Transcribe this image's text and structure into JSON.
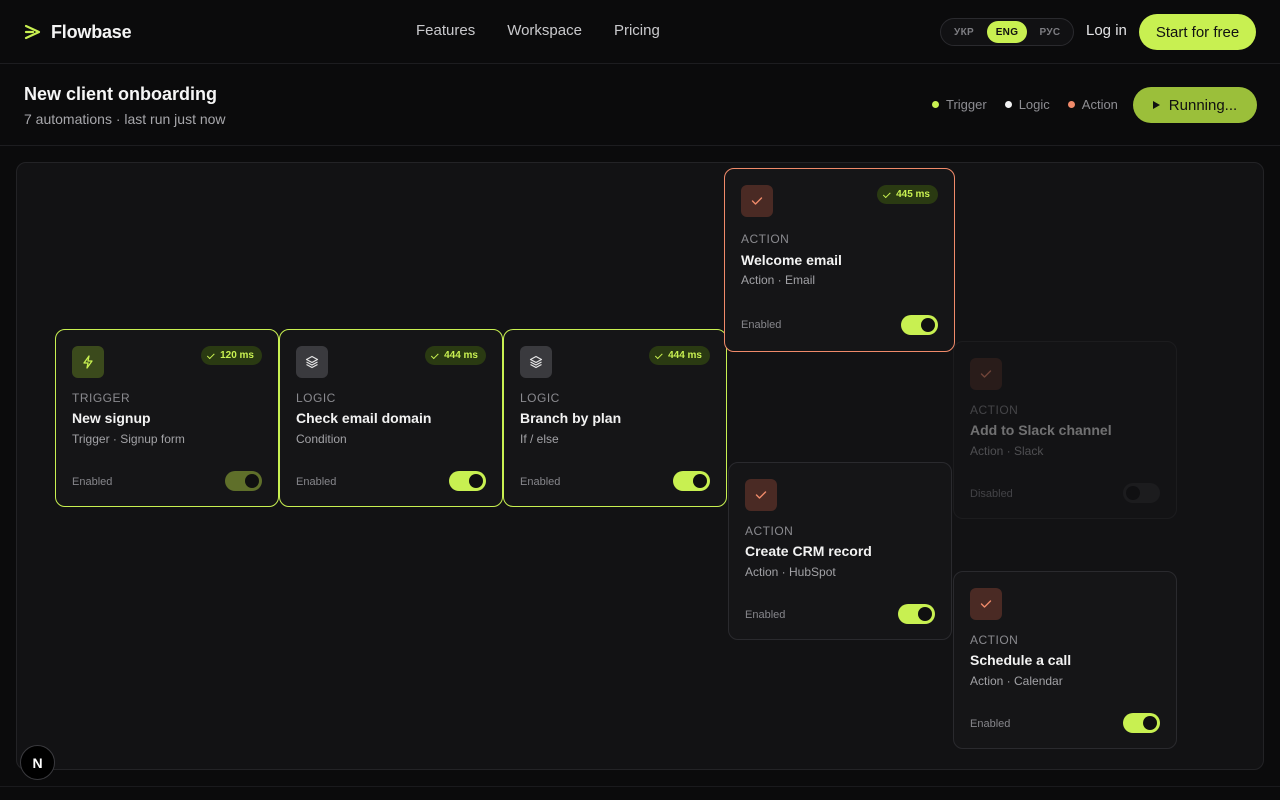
{
  "brand": {
    "name": "Flowbase",
    "accent": "#c8f051"
  },
  "nav": {
    "links": [
      "Features",
      "Workspace",
      "Pricing"
    ],
    "login": "Log in",
    "cta": "Start for free"
  },
  "lang": {
    "options": [
      "УКР",
      "ENG",
      "РУС"
    ],
    "selected": "ENG"
  },
  "header": {
    "title": "New client onboarding",
    "subtitle": "7 automations · last run just now",
    "legend": [
      {
        "label": "Trigger",
        "color": "#c8f051"
      },
      {
        "label": "Logic",
        "color": "#f2f2f2"
      },
      {
        "label": "Action",
        "color": "#f08a6a"
      }
    ],
    "run_label": "Running..."
  },
  "nodes": [
    {
      "kind": "trigger",
      "type": "TRIGGER",
      "title": "New signup",
      "desc": "Trigger · Signup form",
      "badge": "120 ms",
      "status": "Enabled",
      "enabled": true,
      "icon": "bolt-icon"
    },
    {
      "kind": "logic",
      "type": "LOGIC",
      "title": "Check email domain",
      "desc": "Condition",
      "badge": "444 ms",
      "status": "Enabled",
      "enabled": true,
      "icon": "layers-icon"
    },
    {
      "kind": "logic",
      "type": "LOGIC",
      "title": "Branch by plan",
      "desc": "If / else",
      "badge": "444 ms",
      "status": "Enabled",
      "enabled": true,
      "icon": "layers-icon"
    },
    {
      "kind": "action",
      "type": "ACTION",
      "title": "Welcome email",
      "desc": "Action · Email",
      "badge": "445 ms",
      "status": "Enabled",
      "enabled": true,
      "icon": "check-icon"
    },
    {
      "kind": "action",
      "type": "ACTION",
      "title": "Add to Slack channel",
      "desc": "Action · Slack",
      "status": "Disabled",
      "enabled": false,
      "icon": "check-icon"
    },
    {
      "kind": "action",
      "type": "ACTION",
      "title": "Create CRM record",
      "desc": "Action · HubSpot",
      "status": "Enabled",
      "enabled": true,
      "icon": "check-icon"
    },
    {
      "kind": "action",
      "type": "ACTION",
      "title": "Schedule a call",
      "desc": "Action · Calendar",
      "status": "Enabled",
      "enabled": true,
      "icon": "check-icon"
    }
  ],
  "dev_badge": "N"
}
